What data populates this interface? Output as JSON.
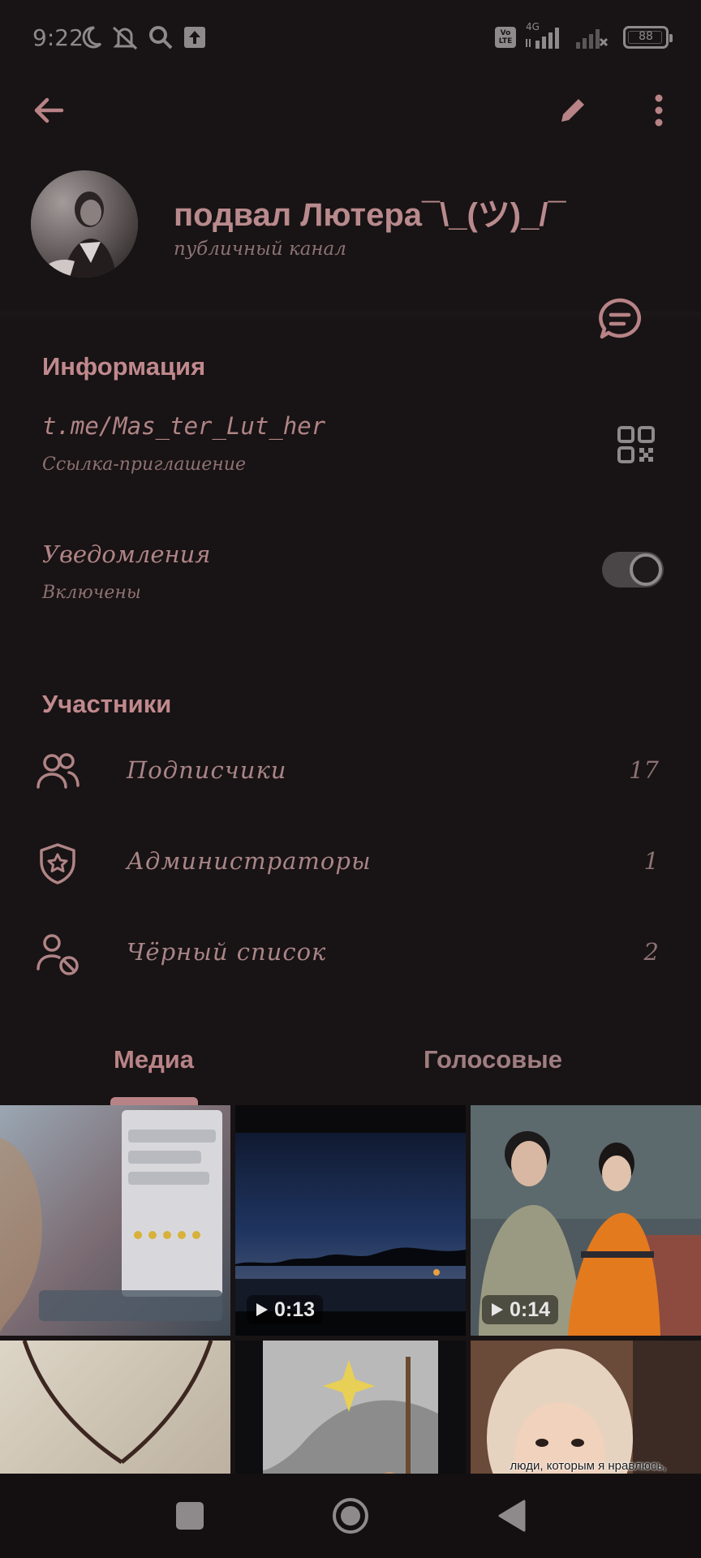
{
  "status_bar": {
    "time": "9:22",
    "volte_badge": "Vo LTE",
    "network": "4G",
    "battery": "88"
  },
  "channel": {
    "name": "подвал Лютера¯\\_(ツ)_/¯",
    "type": "публичный канал"
  },
  "info_section": {
    "title": "Информация",
    "link": "t.me/Mas_ter_Lut_her",
    "link_caption": "Ссылка-приглашение",
    "notifications_label": "Уведомления",
    "notifications_state": "Включены",
    "notifications_enabled": true
  },
  "members_section": {
    "title": "Участники",
    "rows": [
      {
        "label": "Подписчики",
        "count": "17",
        "icon": "people-icon"
      },
      {
        "label": "Администраторы",
        "count": "1",
        "icon": "shield-star-icon"
      },
      {
        "label": "Чёрный список",
        "count": "2",
        "icon": "user-blocked-icon"
      }
    ]
  },
  "tabs": [
    {
      "label": "Медиа",
      "active": true
    },
    {
      "label": "Голосовые",
      "active": false
    }
  ],
  "media": [
    {
      "kind": "photo"
    },
    {
      "kind": "video",
      "duration": "0:13"
    },
    {
      "kind": "video",
      "duration": "0:14"
    },
    {
      "kind": "photo"
    },
    {
      "kind": "photo"
    },
    {
      "kind": "photo",
      "caption": "люди, которым я нравлюсь, вы под чем?"
    }
  ],
  "colors": {
    "background": "#181314",
    "accent": "#b88386",
    "text_primary": "#b08486",
    "text_secondary": "#8e7173"
  }
}
